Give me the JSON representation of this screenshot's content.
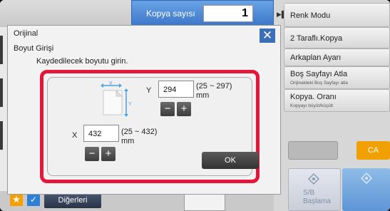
{
  "header": {
    "copy_label": "Kopya sayısı",
    "copy_value": "1"
  },
  "right_panel": {
    "items": [
      {
        "label": "Renk Modu",
        "sub": ""
      },
      {
        "label": "2 Taraflı.Kopya",
        "sub": ""
      },
      {
        "label": "Arkaplan Ayarı",
        "sub": ""
      },
      {
        "label": "Boş Sayfayı Atla",
        "sub": "Orijinaldeki Boş Sayfayı atla"
      },
      {
        "label": "Kopya. Oranı",
        "sub": "Kopyayı büyüt/küçült"
      }
    ],
    "ca_label": "CA",
    "sb_label": "S/B",
    "start_label": "Başlama"
  },
  "dialog": {
    "title": "Orijinal",
    "subtitle": "Boyut Girişi",
    "instruction": "Kaydedilecek boyutu girin.",
    "y": {
      "label": "Y",
      "value": "294",
      "range": "(25 ~ 297)",
      "unit": "mm"
    },
    "x": {
      "label": "X",
      "value": "432",
      "range": "(25 ~ 432)",
      "unit": "mm"
    },
    "ok_label": "OK",
    "minus": "−",
    "plus": "+",
    "close": "✕"
  },
  "bottom": {
    "others_label": "Diğerleri"
  },
  "colors": {
    "accent_blue": "#3d6fb8",
    "highlight_red": "#e4173a",
    "ca_orange": "#f0a000"
  }
}
